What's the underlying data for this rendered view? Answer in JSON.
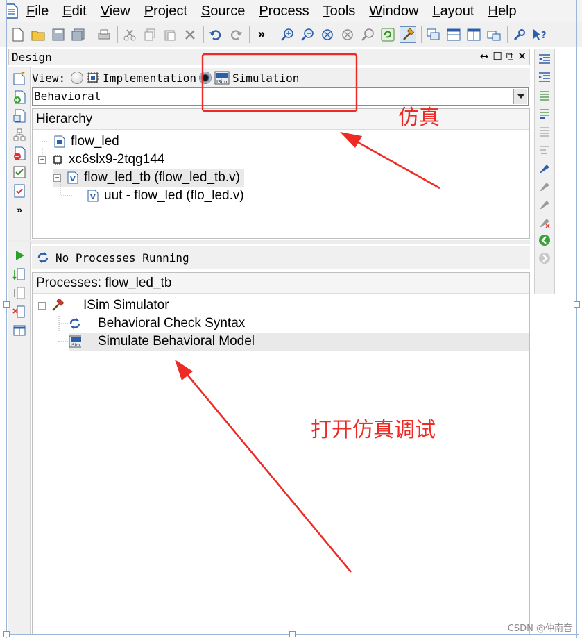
{
  "menu": {
    "items": [
      {
        "first": "F",
        "rest": "ile"
      },
      {
        "first": "E",
        "rest": "dit"
      },
      {
        "first": "V",
        "rest": "iew"
      },
      {
        "first": "P",
        "rest": "roject"
      },
      {
        "first": "S",
        "rest": "ource"
      },
      {
        "first": "P",
        "rest": "rocess"
      },
      {
        "first": "T",
        "rest": "ools"
      },
      {
        "first": "W",
        "rest": "indow"
      },
      {
        "first": "L",
        "rest": "ayout"
      },
      {
        "first": "H",
        "rest": "elp"
      }
    ]
  },
  "toolbar": {
    "overflow": "»"
  },
  "design_panel": {
    "title": "Design",
    "view_label": "View:",
    "view_implementation": "Implementation",
    "view_simulation": "Simulation",
    "combo_value": "Behavioral",
    "hierarchy_header": "Hierarchy",
    "tree": {
      "item1": "flow_led",
      "item2": "xc6slx9-2tqg144",
      "item3": "flow_led_tb (flow_led_tb.v)",
      "item4": "uut - flow_led (flo_led.v)"
    }
  },
  "processes": {
    "status": "No Processes Running",
    "header": "Processes: flow_led_tb",
    "tree": {
      "item1": "ISim Simulator",
      "item2": "Behavioral Check Syntax",
      "item3": "Simulate Behavioral Model"
    }
  },
  "annotations": {
    "label1": "仿真",
    "label2": "打开仿真调试",
    "color": "#ee2a24"
  },
  "watermark": "CSDN @仲南音"
}
